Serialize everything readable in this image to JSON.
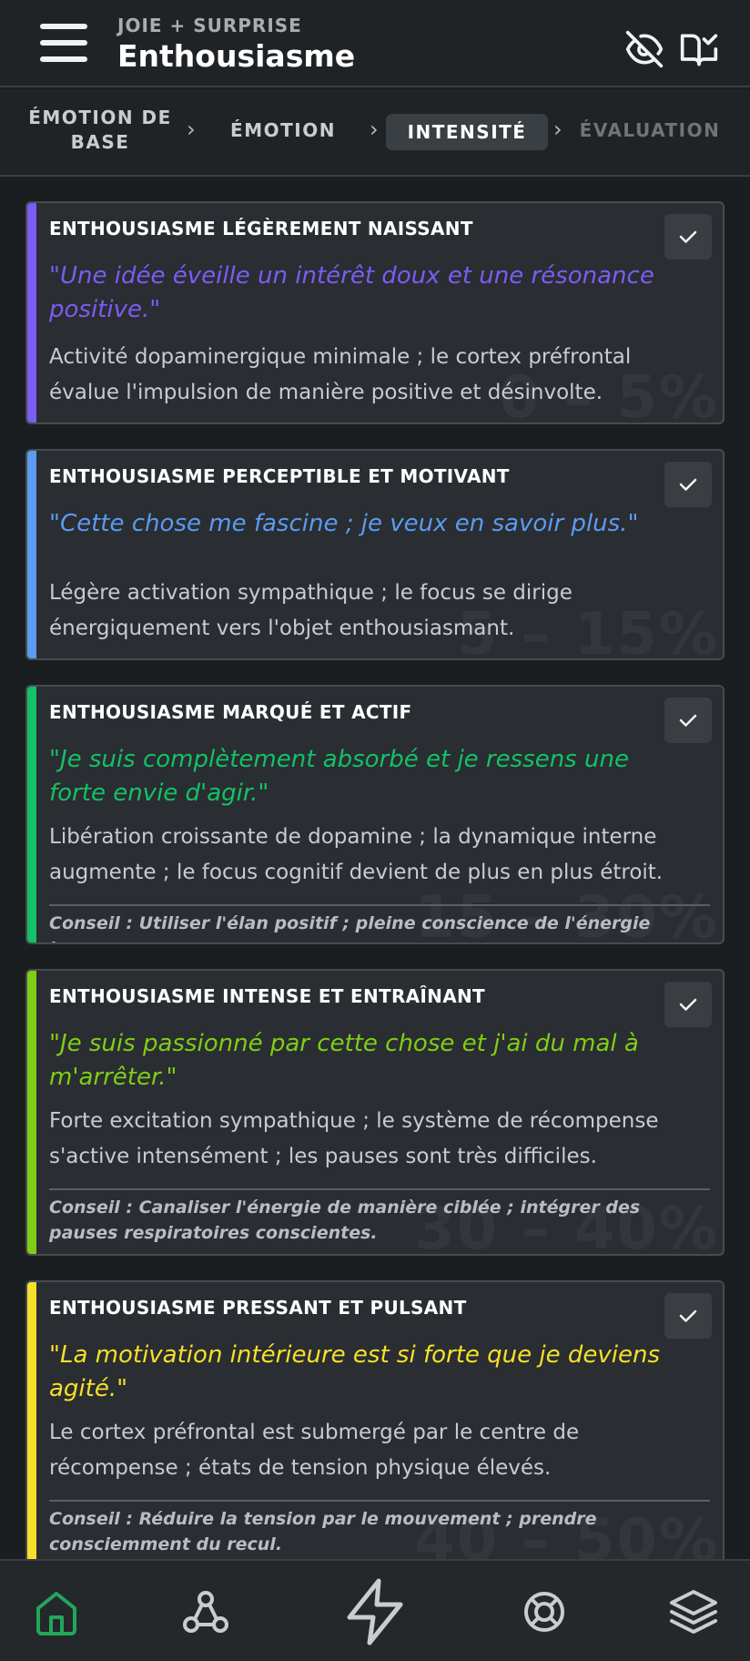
{
  "header": {
    "subtitle": "JOIE + SURPRISE",
    "title": "Enthousiasme",
    "icons": [
      "menu-icon",
      "eye-off-icon",
      "book-check-icon"
    ]
  },
  "stepper": {
    "steps": [
      {
        "line1": "ÉMOTION DE",
        "line2": "BASE"
      },
      {
        "label": "ÉMOTION"
      },
      {
        "label": "INTENSITÉ"
      },
      {
        "label": "ÉVALUATION"
      }
    ],
    "separator": "›",
    "active_index": 2
  },
  "cards": [
    {
      "title": "ENTHOUSIASME LÉGÈREMENT NAISSANT",
      "quote": "\"Une idée éveille un intérêt doux et une résonance positive.\"",
      "description": "Activité dopaminergique minimale ; le cortex préfrontal évalue l'impulsion de manière positive et désinvolte.",
      "range": "0 – 5%",
      "color": "#7b5cf5"
    },
    {
      "title": "ENTHOUSIASME PERCEPTIBLE ET MOTIVANT",
      "quote": "\"Cette chose me fascine ; je veux en savoir plus.\"",
      "description": "Légère activation sympathique ; le focus se dirige énergiquement vers l'objet enthousiasmant.",
      "range": "5 – 15%",
      "color": "#5b9bf2"
    },
    {
      "title": "ENTHOUSIASME MARQUÉ ET ACTIF",
      "quote": "\"Je suis complètement absorbé et je ressens une forte envie d'agir.\"",
      "description": "Libération croissante de dopamine ; la dynamique interne augmente ; le focus cognitif devient de plus en plus étroit.",
      "tip": "Conseil : Utiliser l'élan positif ; pleine conscience de l'énergie joyeuse.",
      "range": "15 – 30%",
      "color": "#12c266"
    },
    {
      "title": "ENTHOUSIASME INTENSE ET ENTRAÎNANT",
      "quote": "\"Je suis passionné par cette chose et j'ai du mal à m'arrêter.\"",
      "description": "Forte excitation sympathique ; le système de récompense s'active intensément ; les pauses sont très difficiles.",
      "tip": "Conseil : Canaliser l'énergie de manière ciblée ; intégrer des pauses respiratoires conscientes.",
      "range": "30 – 40%",
      "color": "#7fce16"
    },
    {
      "title": "ENTHOUSIASME PRESSANT ET PULSANT",
      "quote": "\"La motivation intérieure est si forte que je deviens agité.\"",
      "description": "Le cortex préfrontal est submergé par le centre de récompense ; états de tension physique élevés.",
      "tip": "Conseil : Réduire la tension par le mouvement ; prendre consciemment du recul.",
      "range": "40 – 50%",
      "color": "#f5e02a"
    }
  ],
  "bottom_nav": {
    "items": [
      "home-icon",
      "webhook-icon",
      "zap-icon",
      "lifebuoy-icon",
      "layers-icon"
    ],
    "active_color": "#22a75a"
  }
}
